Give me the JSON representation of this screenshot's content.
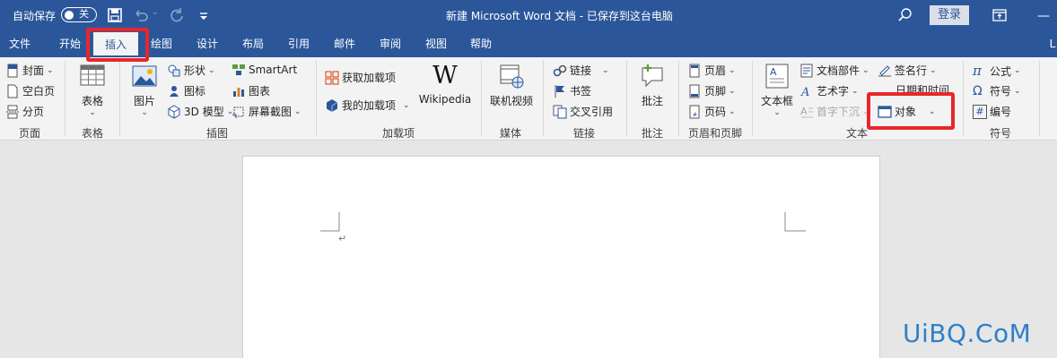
{
  "titlebar": {
    "autosave_label": "自动保存",
    "autosave_state": "关",
    "doc_title": "新建 Microsoft Word 文档 - 已保存到这台电脑",
    "login_label": "登录"
  },
  "tabs": [
    {
      "label": "文件"
    },
    {
      "label": "开始"
    },
    {
      "label": "插入",
      "active": true
    },
    {
      "label": "绘图"
    },
    {
      "label": "设计"
    },
    {
      "label": "布局"
    },
    {
      "label": "引用"
    },
    {
      "label": "邮件"
    },
    {
      "label": "审阅"
    },
    {
      "label": "视图"
    },
    {
      "label": "帮助"
    }
  ],
  "tab_overflow": "L",
  "ribbon": {
    "pages": {
      "cover": "封面",
      "blank": "空白页",
      "break": "分页",
      "group": "页面"
    },
    "tables": {
      "table": "表格",
      "group": "表格"
    },
    "illustrations": {
      "picture": "图片",
      "shapes": "形状",
      "icons": "图标",
      "model3d": "3D 模型",
      "smartart": "SmartArt",
      "chart": "图表",
      "screenshot": "屏幕截图",
      "group": "插图"
    },
    "addins": {
      "get": "获取加载项",
      "mine": "我的加载项",
      "wikipedia": "Wikipedia",
      "wiki_glyph": "W",
      "group": "加载项"
    },
    "media": {
      "video": "联机视频",
      "group": "媒体"
    },
    "links": {
      "link": "链接",
      "bookmark": "书签",
      "crossref": "交叉引用",
      "group": "链接"
    },
    "comments": {
      "comment": "批注",
      "group": "批注"
    },
    "header_footer": {
      "header": "页眉",
      "footer": "页脚",
      "pagenum": "页码",
      "group": "页眉和页脚"
    },
    "text": {
      "textbox": "文本框",
      "quickparts": "文档部件",
      "wordart": "艺术字",
      "dropcap": "首字下沉",
      "signature": "签名行",
      "datetime": "日期和时间",
      "object": "对象",
      "group": "文本"
    },
    "symbols": {
      "equation": "公式",
      "symbol": "符号",
      "number": "编号",
      "group": "符号",
      "pi": "π",
      "omega": "Ω",
      "hash": "#"
    }
  },
  "document": {
    "para_mark": "↵"
  },
  "watermark": "UiBQ.CoM"
}
